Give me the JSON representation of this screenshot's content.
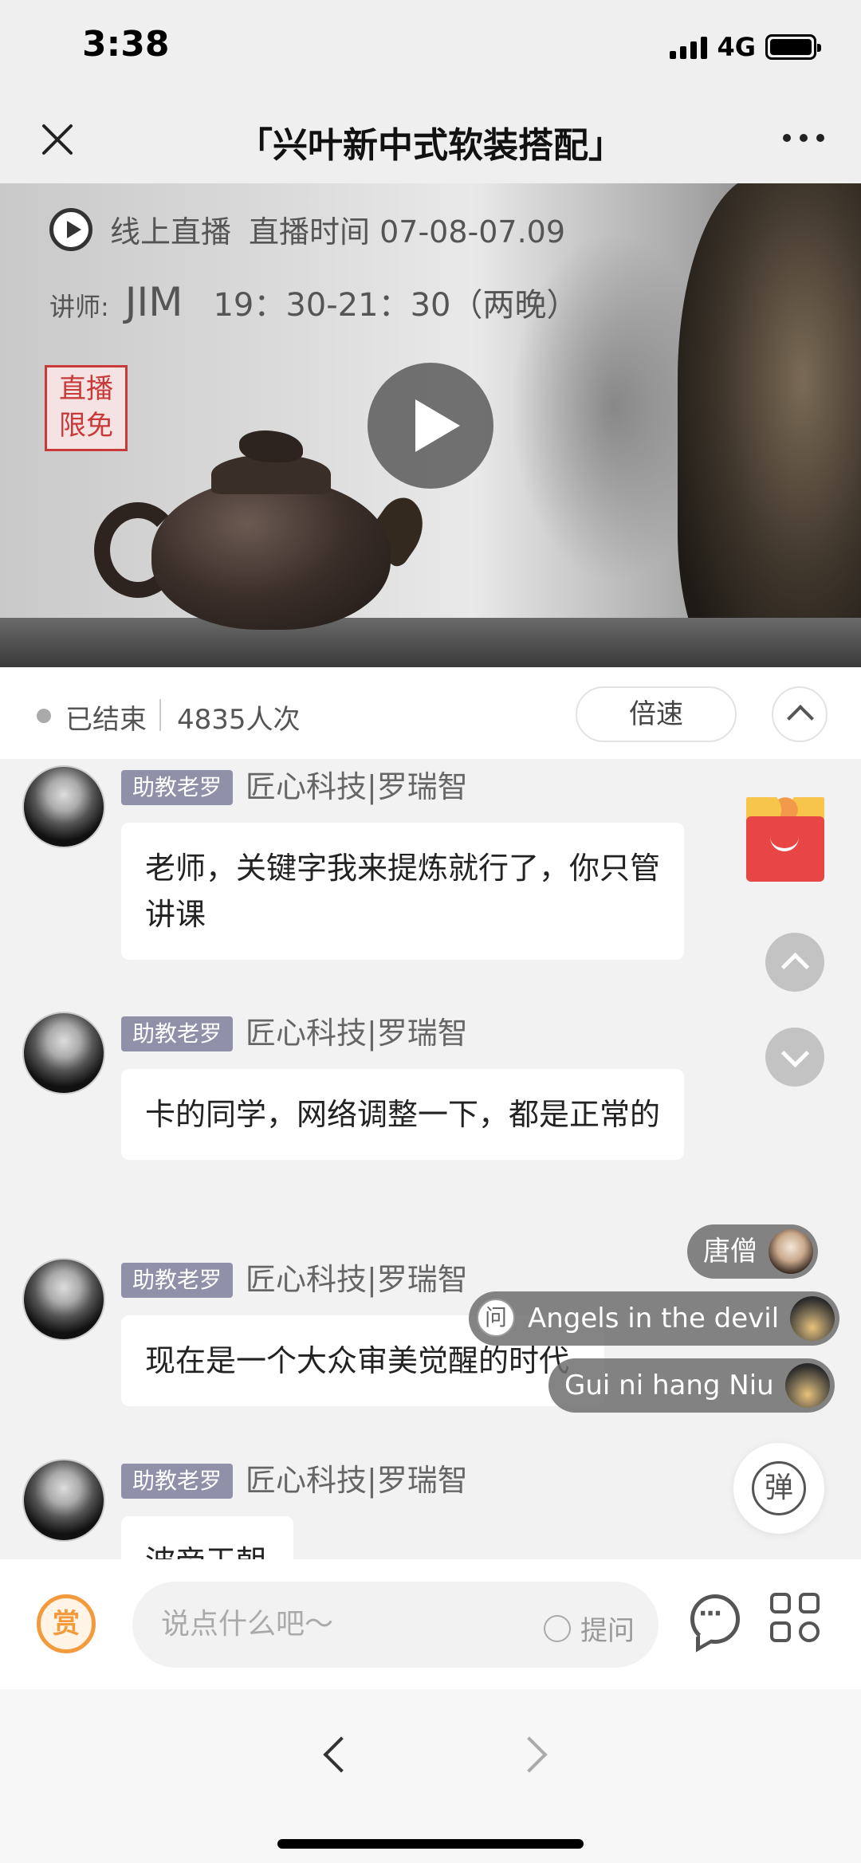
{
  "status_bar": {
    "time": "3:38",
    "network": "4G"
  },
  "nav": {
    "title": "「兴叶新中式软装搭配」"
  },
  "hero": {
    "live_label": "线上直播",
    "live_time_label": "直播时间 07-08-07.09",
    "lecturer_label": "讲师:",
    "lecturer_name": "JIM",
    "session_time": "19：30-21：30（两晚）",
    "seal_line1": "直播",
    "seal_line2": "限免"
  },
  "info_bar": {
    "status": "已结束",
    "view_count": "4835人次",
    "speed_label": "倍速"
  },
  "messages": [
    {
      "role": "助教老罗",
      "name": "匠心科技|罗瑞智",
      "text": "老师，关键字我来提炼就行了，你只管讲课"
    },
    {
      "role": "助教老罗",
      "name": "匠心科技|罗瑞智",
      "text": "卡的同学，网络调整一下，都是正常的"
    },
    {
      "role": "助教老罗",
      "name": "匠心科技|罗瑞智",
      "text": "现在是一个大众审美觉醒的时代"
    },
    {
      "role": "助教老罗",
      "name": "匠心科技|罗瑞智",
      "text": "波帝王朝"
    }
  ],
  "danmu": [
    {
      "text": "唐僧"
    },
    {
      "badge": "问",
      "text": "Angels in the devil"
    },
    {
      "text": "Gui ni hang Niu"
    }
  ],
  "danmu_toggle_label": "弹",
  "input_bar": {
    "reward_label": "赏",
    "placeholder": "说点什么吧～",
    "ask_label": "提问"
  },
  "icons": {
    "close": "close-icon",
    "more": "more-icon",
    "play": "play-icon",
    "gift": "gift-icon",
    "scroll_up": "chevron-up-icon",
    "scroll_down": "chevron-down-icon",
    "comment": "comment-icon",
    "menu": "grid-icon",
    "back": "chevron-left-icon",
    "forward": "chevron-right-icon"
  },
  "colors": {
    "role_badge": "#9090a8",
    "gift_red": "#e84545",
    "reward_orange": "#f39a3c",
    "seal_red": "#c83a3a"
  }
}
